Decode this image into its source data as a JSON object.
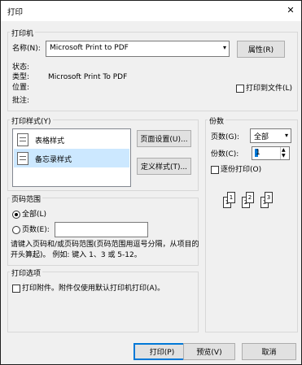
{
  "window": {
    "title": "打印",
    "close_icon": "close-icon"
  },
  "printer": {
    "group_label": "打印机",
    "name_label": "名称(N):",
    "name_value": "Microsoft Print to PDF",
    "properties_button": "属性(R)",
    "status_label": "状态:",
    "type_label": "类型:",
    "type_value": "Microsoft Print To PDF",
    "location_label": "位置:",
    "comment_label": "批注:",
    "print_to_file_label": "打印到文件(L)"
  },
  "print_style": {
    "group_label": "打印样式(Y)",
    "items": [
      {
        "label": "表格样式",
        "selected": false
      },
      {
        "label": "备忘录样式",
        "selected": true
      }
    ],
    "page_setup_button": "页面设置(U)...",
    "define_styles_button": "定义样式(T)..."
  },
  "copies": {
    "group_label": "份数",
    "pages_label": "页数(G):",
    "pages_value": "全部",
    "count_label": "份数(C):",
    "count_value": "1",
    "collate_label": "逐份打印(O)",
    "collate_pages": [
      "1",
      "1",
      "2",
      "2",
      "3",
      "3"
    ]
  },
  "page_range": {
    "group_label": "页码范围",
    "all_label": "全部(L)",
    "pages_label": "页数(E):",
    "pages_input_value": "",
    "help_line1": "请键入页码和/或页码范围(页码范围用逗号分隔，从项目的",
    "help_line2": "开头算起)。  例如: 键入 1、3 或 5-12。"
  },
  "print_options": {
    "group_label": "打印选项",
    "attachments_label": "打印附件。附件仅使用默认打印机打印(A)。"
  },
  "buttons": {
    "print": "打印(P)",
    "preview": "预览(V)",
    "cancel": "取消"
  }
}
